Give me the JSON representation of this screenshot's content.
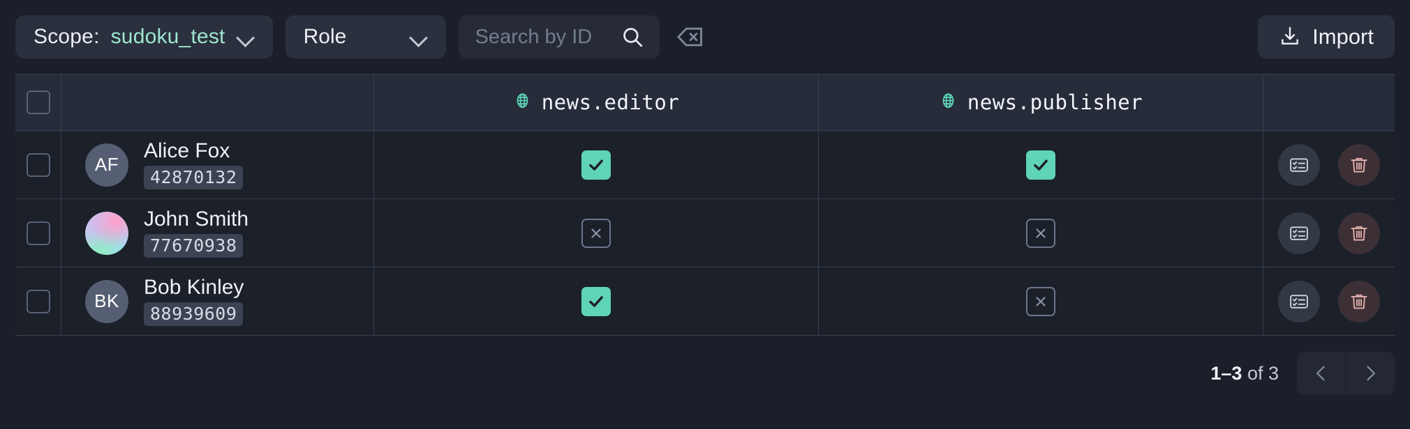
{
  "toolbar": {
    "scope": {
      "label": "Scope:",
      "value": "sudoku_test",
      "chevron_icon": "chevron-down-icon"
    },
    "role": {
      "label": "Role",
      "chevron_icon": "chevron-down-icon"
    },
    "search": {
      "placeholder": "Search by ID",
      "value": "",
      "search_icon": "search-icon",
      "clear_icon": "backspace-clear-icon"
    },
    "import": {
      "label": "Import",
      "icon": "download-icon"
    }
  },
  "table": {
    "header": {
      "select_all_checkbox": "checkbox-unchecked",
      "user_column": "",
      "permission_columns": [
        {
          "label": "news.editor",
          "icon": "globe-icon"
        },
        {
          "label": "news.publisher",
          "icon": "globe-icon"
        }
      ],
      "actions_column": ""
    },
    "rows": [
      {
        "checkbox": "checkbox-unchecked",
        "avatar": {
          "type": "initials",
          "initials": "AF"
        },
        "name": "Alice Fox",
        "id": "42870132",
        "permissions": [
          "granted",
          "granted"
        ],
        "actions": [
          {
            "name": "edit-permissions",
            "icon": "list-card-icon"
          },
          {
            "name": "delete",
            "icon": "trash-icon"
          }
        ]
      },
      {
        "checkbox": "checkbox-unchecked",
        "avatar": {
          "type": "gradient",
          "initials": ""
        },
        "name": "John Smith",
        "id": "77670938",
        "permissions": [
          "denied",
          "denied"
        ],
        "actions": [
          {
            "name": "edit-permissions",
            "icon": "list-card-icon"
          },
          {
            "name": "delete",
            "icon": "trash-icon"
          }
        ]
      },
      {
        "checkbox": "checkbox-unchecked",
        "avatar": {
          "type": "initials",
          "initials": "BK"
        },
        "name": "Bob Kinley",
        "id": "88939609",
        "permissions": [
          "granted",
          "denied"
        ],
        "actions": [
          {
            "name": "edit-permissions",
            "icon": "list-card-icon"
          },
          {
            "name": "delete",
            "icon": "trash-icon"
          }
        ]
      }
    ]
  },
  "footer": {
    "range": "1–3",
    "of_text": "of 3",
    "prev_icon": "chevron-left-icon",
    "next_icon": "chevron-right-icon"
  },
  "colors": {
    "accent_mint": "#9fe6cf",
    "check_green": "#5fd4b6",
    "globe_teal": "#5fd4b6",
    "trash_pink": "#e5b0ac",
    "page_bg": "#1b1f2a",
    "header_bg": "#262c39",
    "row_bg": "#1b2029",
    "border": "#39404f"
  }
}
